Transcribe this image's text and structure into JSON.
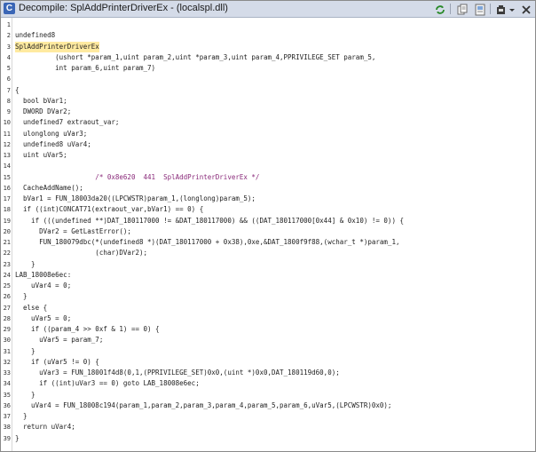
{
  "window": {
    "title": "Decompile: SplAddPrinterDriverEx - (localspl.dll)",
    "title_icon": "C",
    "toolbar_icons": [
      "refresh-icon",
      "copy-icon",
      "snapshot-icon",
      "export-icon",
      "dropdown-icon",
      "close-icon"
    ],
    "colors": {
      "titlebar": "#d4dbe8",
      "highlight": "#ffeaa0",
      "cursor": "#e11111"
    }
  },
  "code": {
    "lines": [
      {
        "n": "1",
        "text": ""
      },
      {
        "n": "2",
        "text": "undefined8"
      },
      {
        "n": "3",
        "text": "SplAddPrinterDriverEx"
      },
      {
        "n": "4",
        "text": "          (ushort *param_1,uint param_2,uint *param_3,uint param_4,PPRIVILEGE_SET param_5,"
      },
      {
        "n": "5",
        "text": "          int param_6,uint param_7)"
      },
      {
        "n": "6",
        "text": ""
      },
      {
        "n": "7",
        "text": "{"
      },
      {
        "n": "8",
        "text": "  bool bVar1;"
      },
      {
        "n": "9",
        "text": "  DWORD DVar2;"
      },
      {
        "n": "10",
        "text": "  undefined7 extraout_var;"
      },
      {
        "n": "11",
        "text": "  ulonglong uVar3;"
      },
      {
        "n": "12",
        "text": "  undefined8 uVar4;"
      },
      {
        "n": "13",
        "text": "  uint uVar5;"
      },
      {
        "n": "14",
        "text": ""
      },
      {
        "n": "15",
        "text": "                    /* 0x8e620  441  SplAddPrinterDriverEx */"
      },
      {
        "n": "16",
        "text": "  CacheAddName();"
      },
      {
        "n": "17",
        "text": "  bVar1 = FUN_18003da20((LPCWSTR)param_1,(longlong)param_5);"
      },
      {
        "n": "18",
        "text": "  if ((int)CONCAT71(extraout_var,bVar1) == 0) {"
      },
      {
        "n": "19",
        "text": "    if (((undefined **)DAT_180117000 != &DAT_180117000) && ((DAT_180117000[0x44] & 0x10) != 0)) {"
      },
      {
        "n": "20",
        "text": "      DVar2 = GetLastError();"
      },
      {
        "n": "21",
        "text": "      FUN_180079dbc(*(undefined8 *)(DAT_180117000 + 0x38),0xe,&DAT_1800f9f88,(wchar_t *)param_1,"
      },
      {
        "n": "22",
        "text": "                    (char)DVar2);"
      },
      {
        "n": "23",
        "text": "    }"
      },
      {
        "n": "24",
        "text": "LAB_18008e6ec:"
      },
      {
        "n": "25",
        "text": "    uVar4 = 0;"
      },
      {
        "n": "26",
        "text": "  }"
      },
      {
        "n": "27",
        "text": "  else {"
      },
      {
        "n": "28",
        "text": "    uVar5 = 0;"
      },
      {
        "n": "29",
        "text": "    if ((param_4 >> 0xf & 1) == 0) {"
      },
      {
        "n": "30",
        "text": "      uVar5 = param_7;"
      },
      {
        "n": "31",
        "text": "    }"
      },
      {
        "n": "32",
        "text": "    if (uVar5 != 0) {"
      },
      {
        "n": "33",
        "text": "      uVar3 = FUN_18001f4d8(0,1,(PPRIVILEGE_SET)0x0,(uint *)0x0,DAT_180119d60,0);"
      },
      {
        "n": "34",
        "text": "      if ((int)uVar3 == 0) goto LAB_18008e6ec;"
      },
      {
        "n": "35",
        "text": "    }"
      },
      {
        "n": "36",
        "text": "    uVar4 = FUN_18008c194(param_1,param_2,param_3,param_4,param_5,param_6,uVar5,(LPCWSTR)0x0);"
      },
      {
        "n": "37",
        "text": "  }"
      },
      {
        "n": "38",
        "text": "  return uVar4;"
      },
      {
        "n": "39",
        "text": "}"
      }
    ]
  }
}
